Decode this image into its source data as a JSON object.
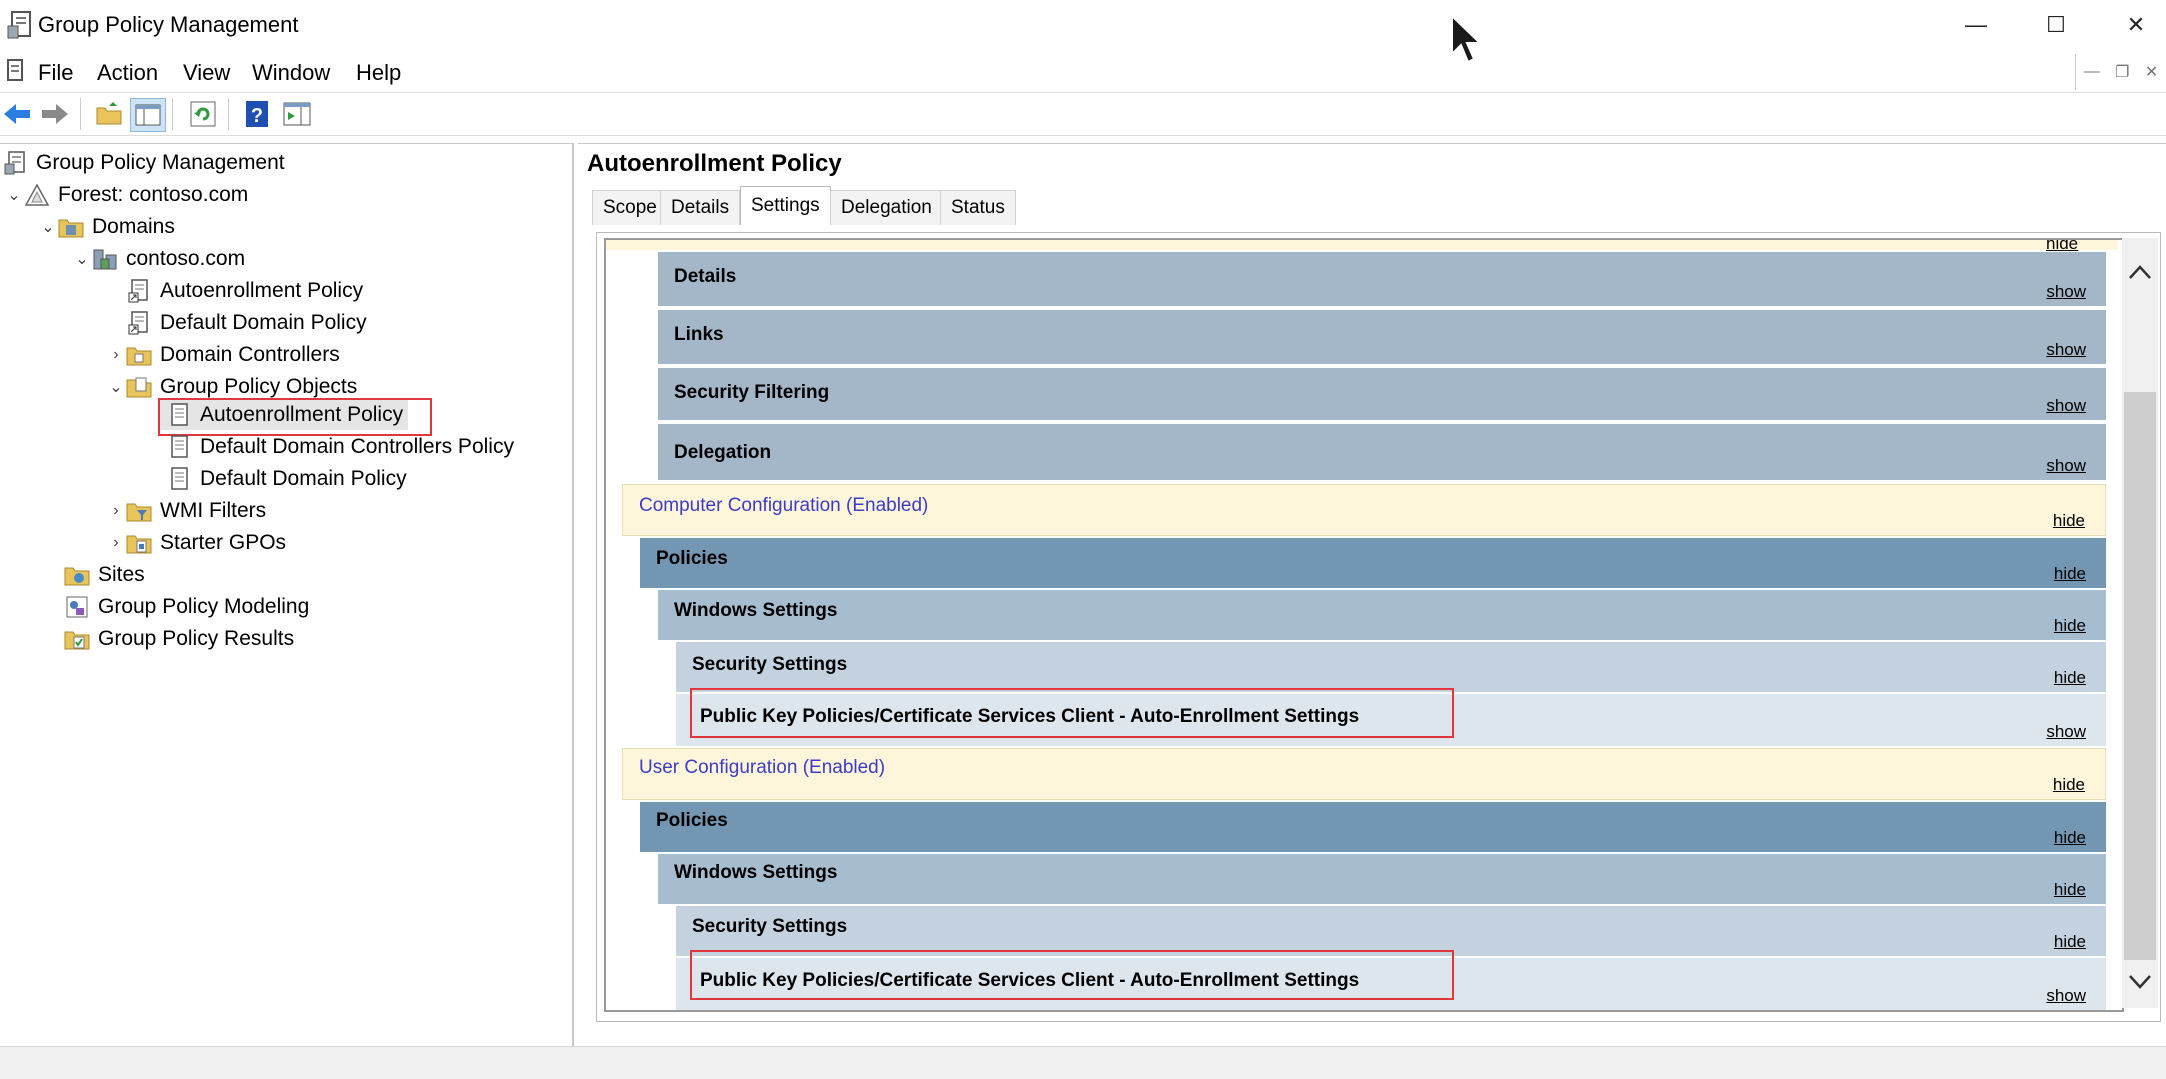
{
  "window": {
    "title": "Group Policy Management",
    "minimize": "—",
    "maximize": "☐",
    "close": "✕"
  },
  "menu": [
    "File",
    "Action",
    "View",
    "Window",
    "Help"
  ],
  "tree": {
    "root": "Group Policy Management",
    "forest": "Forest: contoso.com",
    "domains": "Domains",
    "domain": "contoso.com",
    "linked_gpos": [
      "Autoenrollment Policy",
      "Default Domain Policy"
    ],
    "domain_controllers": "Domain Controllers",
    "gpo_container": "Group Policy Objects",
    "gpos": [
      "Autoenrollment Policy",
      "Default Domain Controllers Policy",
      "Default Domain Policy"
    ],
    "wmi_filters": "WMI Filters",
    "starter_gpos": "Starter GPOs",
    "sites": "Sites",
    "modeling": "Group Policy Modeling",
    "results": "Group Policy Results"
  },
  "right": {
    "title": "Autoenrollment Policy",
    "tabs": [
      "Scope",
      "Details",
      "Settings",
      "Delegation",
      "Status"
    ],
    "active_tab": "Settings"
  },
  "report": {
    "top_link": "hide",
    "general_sections": [
      {
        "label": "Details",
        "link": "show"
      },
      {
        "label": "Links",
        "link": "show"
      },
      {
        "label": "Security Filtering",
        "link": "show"
      },
      {
        "label": "Delegation",
        "link": "show"
      }
    ],
    "computer": {
      "label": "Computer Configuration (Enabled)",
      "link": "hide",
      "policies": {
        "label": "Policies",
        "link": "hide"
      },
      "windows": {
        "label": "Windows Settings",
        "link": "hide"
      },
      "security": {
        "label": "Security Settings",
        "link": "hide"
      },
      "pki": {
        "label": "Public Key Policies/Certificate Services Client - Auto-Enrollment Settings",
        "link": "show"
      }
    },
    "user": {
      "label": "User Configuration (Enabled)",
      "link": "hide",
      "policies": {
        "label": "Policies",
        "link": "hide"
      },
      "windows": {
        "label": "Windows Settings",
        "link": "hide"
      },
      "security": {
        "label": "Security Settings",
        "link": "hide"
      },
      "pki": {
        "label": "Public Key Policies/Certificate Services Client - Auto-Enrollment Settings",
        "link": "show"
      }
    }
  },
  "colors": {
    "highlight": "#e0363c",
    "config_text": "#3c3cc8",
    "config_bg": "#fef6da",
    "policies_bg": "#7396b2"
  }
}
